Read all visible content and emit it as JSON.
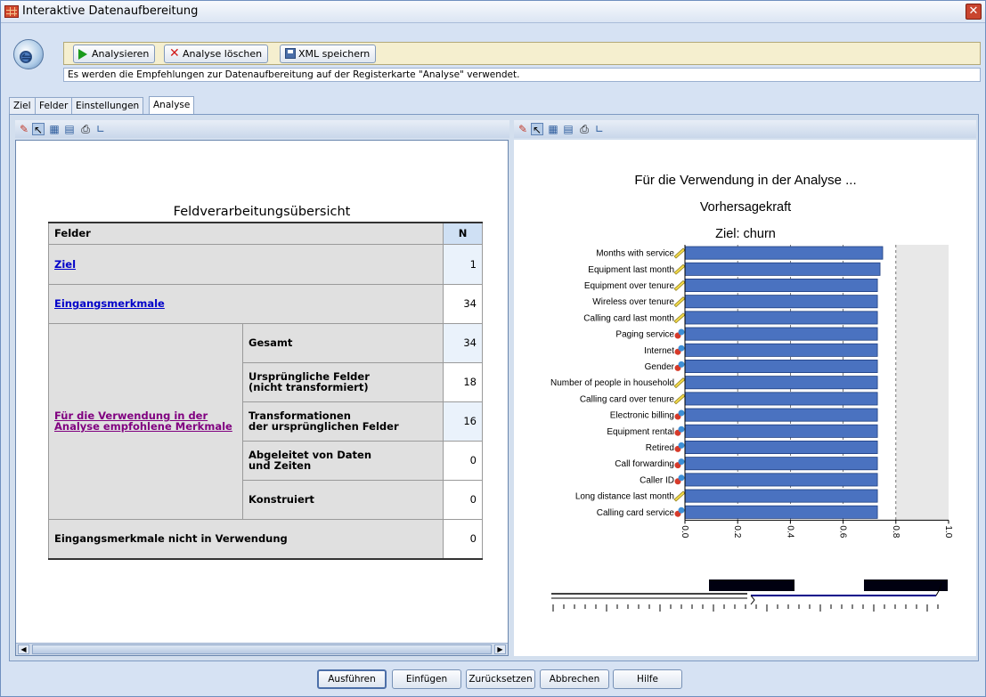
{
  "window": {
    "title": "Interaktive Datenaufbereitung"
  },
  "toolbar": {
    "analyze_label": "Analysieren",
    "clear_label": "Analyse löschen",
    "save_xml_label": "XML speichern",
    "info_text": "Es werden die Empfehlungen zur Datenaufbereitung auf der Registerkarte \"Analyse\" verwendet."
  },
  "tabs": [
    {
      "label": "Ziel",
      "active": false
    },
    {
      "label": "Felder",
      "active": false
    },
    {
      "label": "Einstellungen",
      "active": false
    },
    {
      "label": "Analyse",
      "active": true
    }
  ],
  "summary": {
    "title": "Feldverarbeitungsübersicht",
    "col_fields": "Felder",
    "col_n": "N",
    "rows": {
      "ziel": {
        "label": "Ziel",
        "n": "1"
      },
      "inputs": {
        "label": "Eingangsmerkmale",
        "n": "34"
      },
      "recommended": {
        "label": "Für die Verwendung in der Analyse empfohlene Merkmale",
        "sub": [
          {
            "label": "Gesamt",
            "n": "34"
          },
          {
            "label": "Ursprüngliche Felder\n(nicht transformiert)",
            "n": "18"
          },
          {
            "label": "Transformationen\nder ursprünglichen Felder",
            "n": "16"
          },
          {
            "label": "Abgeleitet von Daten\nund Zeiten",
            "n": "0"
          },
          {
            "label": "Konstruiert",
            "n": "0"
          }
        ]
      },
      "unused": {
        "label": "Eingangsmerkmale nicht in Verwendung",
        "n": "0"
      }
    }
  },
  "chart_data": {
    "type": "bar",
    "orientation": "horizontal",
    "title": "Für die Verwendung in der Analyse ...",
    "subtitle": "Vorhersagekraft",
    "subtitle2": "Ziel: churn",
    "bar_color": "#4a72c0",
    "categories": [
      "Months with service",
      "Equipment last month",
      "Equipment over tenure",
      "Wireless over tenure",
      "Calling card last month",
      "Paging service",
      "Internet",
      "Gender",
      "Number of people in household",
      "Calling card over tenure",
      "Electronic billing",
      "Equipment rental",
      "Retired",
      "Call forwarding",
      "Caller ID",
      "Long distance last month",
      "Calling card service"
    ],
    "icon_types": [
      "ruler",
      "ruler",
      "ruler",
      "ruler",
      "ruler",
      "nominal",
      "nominal",
      "nominal",
      "ruler",
      "ruler",
      "nominal",
      "nominal",
      "nominal",
      "nominal",
      "nominal",
      "ruler",
      "nominal"
    ],
    "values": [
      0.75,
      0.74,
      0.73,
      0.73,
      0.73,
      0.73,
      0.73,
      0.73,
      0.73,
      0.73,
      0.73,
      0.73,
      0.73,
      0.73,
      0.73,
      0.73,
      0.73
    ],
    "xlim": [
      0,
      1.0
    ],
    "xticks": [
      "0.0",
      "0.2",
      "0.4",
      "0.6",
      "0.8",
      "1.0"
    ],
    "grid": true,
    "shaded_from": 0.8
  },
  "buttons": {
    "run": "Ausführen",
    "paste": "Einfügen",
    "reset": "Zurücksetzen",
    "cancel": "Abbrechen",
    "help": "Hilfe"
  }
}
